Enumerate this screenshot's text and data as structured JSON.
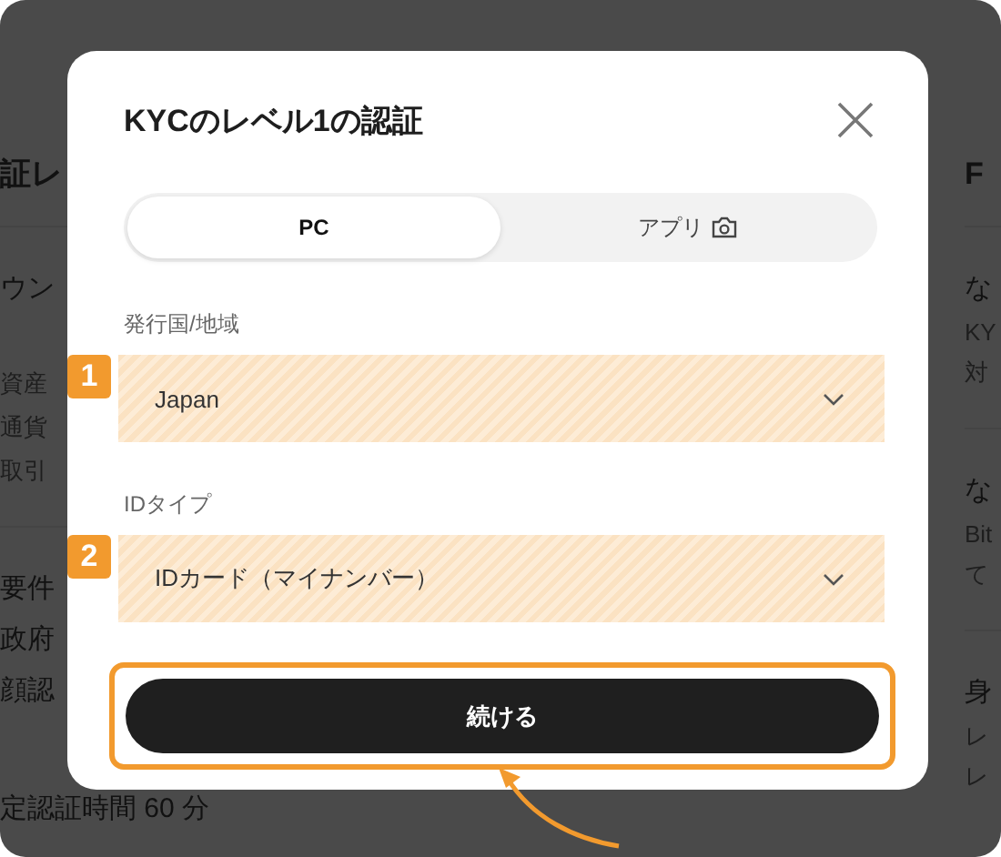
{
  "background": {
    "left_groups": [
      [
        {
          "kind": "title",
          "text": "証レ"
        }
      ],
      [
        {
          "kind": "item",
          "text": "ウン"
        },
        {
          "kind": "muted",
          "text": "資産"
        },
        {
          "kind": "muted",
          "text": "通貨"
        },
        {
          "kind": "muted",
          "text": "取引"
        }
      ],
      [
        {
          "kind": "item",
          "text": "要件"
        },
        {
          "kind": "item",
          "text": "政府"
        },
        {
          "kind": "item",
          "text": "顔認"
        }
      ],
      [
        {
          "kind": "item",
          "text": "定認証時間 60 分"
        }
      ]
    ],
    "right_groups": [
      [
        {
          "kind": "title",
          "text": "F"
        }
      ],
      [
        {
          "kind": "item",
          "text": "な"
        },
        {
          "kind": "muted",
          "text": "KY"
        },
        {
          "kind": "muted",
          "text": "対"
        }
      ],
      [
        {
          "kind": "item",
          "text": "な"
        },
        {
          "kind": "muted",
          "text": "Bit"
        },
        {
          "kind": "muted",
          "text": "て"
        }
      ],
      [
        {
          "kind": "item",
          "text": "身"
        },
        {
          "kind": "muted",
          "text": "レ"
        },
        {
          "kind": "muted",
          "text": "レ"
        }
      ]
    ]
  },
  "dialog": {
    "title": "KYCのレベル1の認証",
    "tabs": [
      {
        "label": "PC",
        "selected": true
      },
      {
        "label": "アプリ",
        "selected": false
      }
    ],
    "fields": [
      {
        "label": "発行国/地域",
        "value": "Japan",
        "marker": "1",
        "highlighted": true
      },
      {
        "label": "IDタイプ",
        "value": "IDカード（マイナンバー）",
        "marker": "2",
        "highlighted": true
      }
    ],
    "button": {
      "label": "続ける",
      "highlighted": true
    }
  }
}
